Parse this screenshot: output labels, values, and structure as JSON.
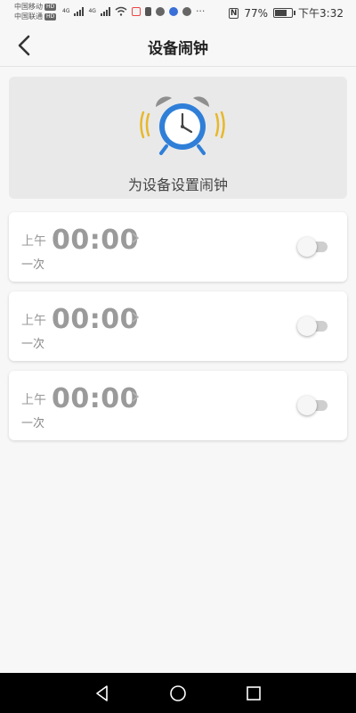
{
  "status_bar": {
    "carrier1": "中国移动",
    "carrier2": "中国联通",
    "hd": "HD",
    "net1": "4G",
    "net2": "4G",
    "battery_percent": "77%",
    "battery_level": 0.77,
    "time": "下午3:32",
    "nfc": "N"
  },
  "header": {
    "title": "设备闹钟"
  },
  "banner": {
    "text": "为设备设置闹钟"
  },
  "alarms": [
    {
      "ampm": "上午",
      "time": "00:00",
      "repeat": "一次",
      "enabled": false
    },
    {
      "ampm": "上午",
      "time": "00:00",
      "repeat": "一次",
      "enabled": false
    },
    {
      "ampm": "上午",
      "time": "00:00",
      "repeat": "一次",
      "enabled": false
    }
  ],
  "colors": {
    "clock_blue": "#2f7fd8",
    "bell_gray": "#8f8f8f",
    "shake_yellow": "#e8b82a"
  }
}
